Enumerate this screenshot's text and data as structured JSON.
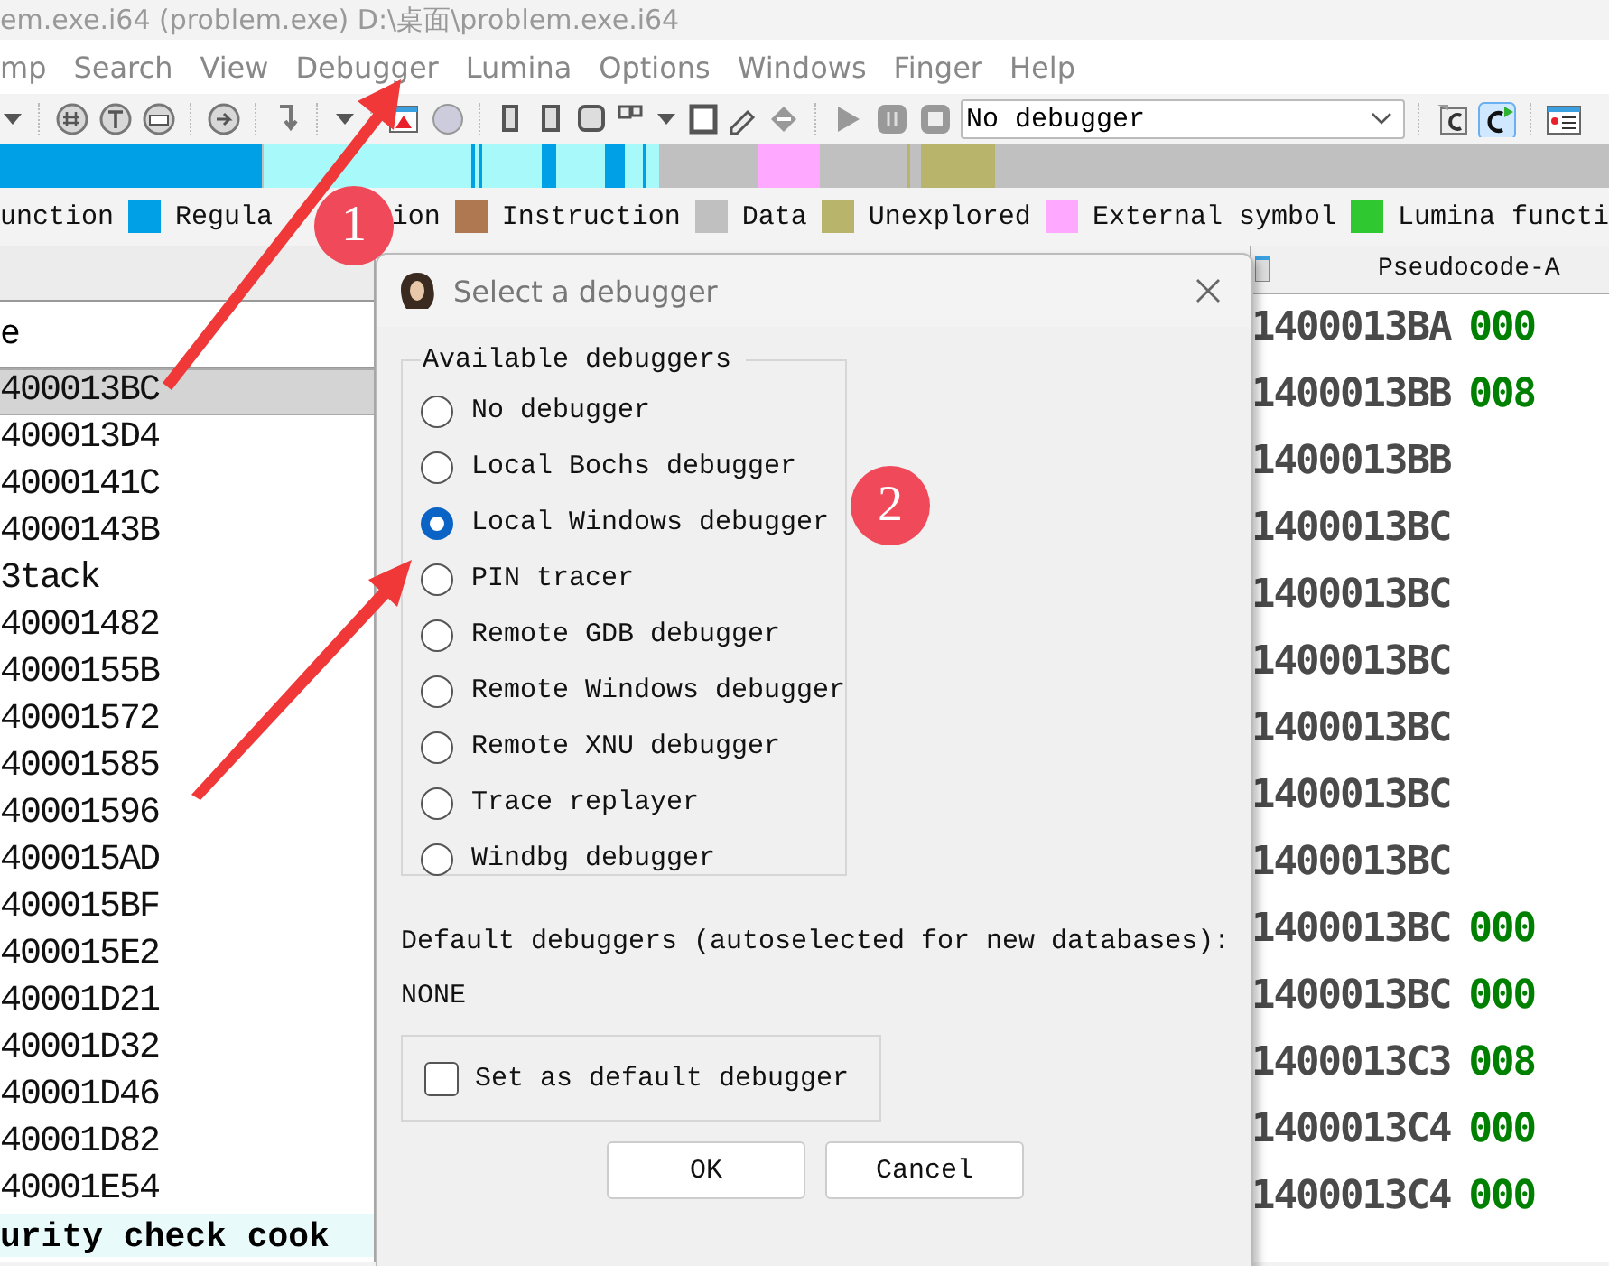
{
  "window": {
    "title": "em.exe.i64 (problem.exe) D:\\桌面\\problem.exe.i64"
  },
  "menu": [
    "mp",
    "Search",
    "View",
    "Debugger",
    "Lumina",
    "Options",
    "Windows",
    "Finger",
    "Help"
  ],
  "toolbar": {
    "debugger_select": "No debugger"
  },
  "legend": [
    {
      "label": "unction"
    },
    {
      "label": "Regula",
      "tail": "ion",
      "color": "#00a0e6"
    },
    {
      "label": "Instruction",
      "color": "#b07850"
    },
    {
      "label": "Data",
      "color": "#c0c0c0"
    },
    {
      "label": "Unexplored",
      "color": "#b8b46c"
    },
    {
      "label": "External symbol",
      "color": "#ffa8ff"
    },
    {
      "label": "Lumina functi",
      "color": "#30c830"
    }
  ],
  "left_pane": {
    "column_header": "e",
    "rows": [
      {
        "text": "400013BC",
        "selected": true
      },
      {
        "text": "400013D4",
        "selected": false
      },
      {
        "text": "4000141C",
        "selected": false
      },
      {
        "text": "4000143B",
        "selected": false
      },
      {
        "text": "3tack",
        "selected": false
      },
      {
        "text": "40001482",
        "selected": false
      },
      {
        "text": "4000155B",
        "selected": false
      },
      {
        "text": "40001572",
        "selected": false
      },
      {
        "text": "40001585",
        "selected": false
      },
      {
        "text": "40001596",
        "selected": false
      },
      {
        "text": "400015AD",
        "selected": false
      },
      {
        "text": "400015BF",
        "selected": false
      },
      {
        "text": "400015E2",
        "selected": false
      },
      {
        "text": "40001D21",
        "selected": false
      },
      {
        "text": "40001D32",
        "selected": false
      },
      {
        "text": "40001D46",
        "selected": false
      },
      {
        "text": "40001D82",
        "selected": false
      },
      {
        "text": "40001E54",
        "selected": false
      }
    ],
    "footer": "urity check cook"
  },
  "right_pane": {
    "tab": "Pseudocode-A",
    "rows": [
      {
        "address": "1400013BA",
        "bytes": "000"
      },
      {
        "address": "1400013BB",
        "bytes": "008"
      },
      {
        "address": "1400013BB"
      },
      {
        "address": "1400013BC"
      },
      {
        "address": "1400013BC"
      },
      {
        "address": "1400013BC"
      },
      {
        "address": "1400013BC"
      },
      {
        "address": "1400013BC"
      },
      {
        "address": "1400013BC"
      },
      {
        "address": "1400013BC",
        "bytes": "000"
      },
      {
        "address": "1400013BC",
        "bytes": "000"
      },
      {
        "address": "1400013C3",
        "bytes": "008"
      },
      {
        "address": "1400013C4",
        "bytes": "000"
      },
      {
        "address": "1400013C4",
        "bytes": "000"
      }
    ]
  },
  "dialog": {
    "title": "Select a debugger",
    "group_title": "Available debuggers",
    "options": [
      {
        "label": "No debugger",
        "selected": false
      },
      {
        "label": "Local Bochs debugger",
        "selected": false
      },
      {
        "label": "Local Windows debugger",
        "selected": true
      },
      {
        "label": "PIN tracer",
        "selected": false
      },
      {
        "label": "Remote GDB debugger",
        "selected": false
      },
      {
        "label": "Remote Windows debugger",
        "selected": false
      },
      {
        "label": "Remote XNU debugger",
        "selected": false
      },
      {
        "label": "Trace replayer",
        "selected": false
      },
      {
        "label": "Windbg debugger",
        "selected": false
      }
    ],
    "default_label": "Default debuggers (autoselected for new databases):",
    "default_value": "NONE",
    "checkbox": {
      "label": "Set as default debugger",
      "checked": false
    },
    "buttons": [
      "OK",
      "Cancel"
    ]
  },
  "annotations": [
    {
      "number": "1"
    },
    {
      "number": "2"
    }
  ]
}
